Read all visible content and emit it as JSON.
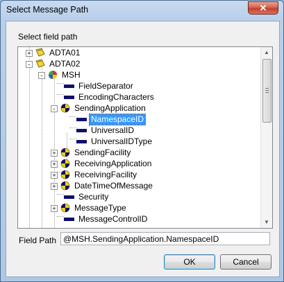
{
  "window": {
    "title": "Select Message Path",
    "close_glyph": "✕"
  },
  "tree": {
    "label": "Select field path",
    "rows": [
      {
        "label": "ADTA01",
        "icon": "message-icon",
        "expander": "+"
      },
      {
        "label": "ADTA02",
        "icon": "message-icon",
        "expander": "-"
      },
      {
        "label": "MSH",
        "icon": "segment-icon",
        "expander": "-"
      },
      {
        "label": "FieldSeparator",
        "icon": "field-icon",
        "expander": ""
      },
      {
        "label": "EncodingCharacters",
        "icon": "field-icon",
        "expander": ""
      },
      {
        "label": "SendingApplication",
        "icon": "composite-icon",
        "expander": "-"
      },
      {
        "label": "NamespaceID",
        "icon": "field-icon",
        "expander": "",
        "selected": true
      },
      {
        "label": "UniversalID",
        "icon": "field-icon",
        "expander": ""
      },
      {
        "label": "UniversalIDType",
        "icon": "field-icon",
        "expander": ""
      },
      {
        "label": "SendingFacility",
        "icon": "composite-icon",
        "expander": "+"
      },
      {
        "label": "ReceivingApplication",
        "icon": "composite-icon",
        "expander": "+"
      },
      {
        "label": "ReceivingFacility",
        "icon": "composite-icon",
        "expander": "+"
      },
      {
        "label": "DateTimeOfMessage",
        "icon": "composite-icon",
        "expander": "+"
      },
      {
        "label": "Security",
        "icon": "field-icon",
        "expander": ""
      },
      {
        "label": "MessageType",
        "icon": "composite-icon",
        "expander": "+"
      },
      {
        "label": "MessageControlID",
        "icon": "field-icon",
        "expander": ""
      }
    ]
  },
  "field_path": {
    "label": "Field Path",
    "value": "@MSH.SendingApplication.NamespaceID"
  },
  "buttons": {
    "ok": "OK",
    "cancel": "Cancel"
  }
}
